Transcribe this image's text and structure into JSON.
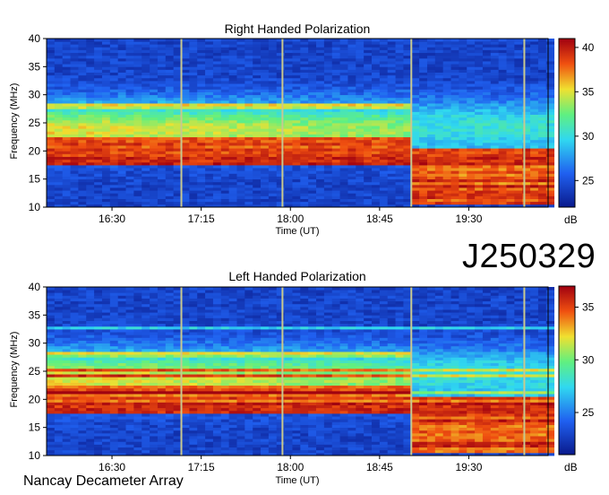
{
  "identifier": "J250329",
  "observatory": "Nancay Decameter Array",
  "chart_data": [
    {
      "type": "heatmap",
      "title": "Right Handed Polarization",
      "xlabel": "Time (UT)",
      "ylabel": "Frequency (MHz)",
      "x_ticks": [
        "16:30",
        "17:15",
        "18:00",
        "18:45",
        "19:30"
      ],
      "y_ticks": [
        10,
        15,
        20,
        25,
        30,
        35,
        40
      ],
      "ylim": [
        10,
        40
      ],
      "colorbar": {
        "ticks": [
          25,
          30,
          35,
          40
        ],
        "units": "dB",
        "range": [
          22,
          41
        ]
      },
      "features": {
        "vertical_lines_time": [
          "17:05",
          "17:56",
          "19:01",
          "19:58"
        ],
        "bands_before_19_00_MHz": [
          [
            17.5,
            22.5
          ],
          [
            27.5,
            28.5
          ]
        ],
        "bands_after_19_00_MHz": [
          [
            10.5,
            20.5
          ]
        ]
      }
    },
    {
      "type": "heatmap",
      "title": "Left Handed Polarization",
      "xlabel": "Time (UT)",
      "ylabel": "Frequency (MHz)",
      "x_ticks": [
        "16:30",
        "17:15",
        "18:00",
        "18:45",
        "19:30"
      ],
      "y_ticks": [
        10,
        15,
        20,
        25,
        30,
        35,
        40
      ],
      "ylim": [
        10,
        40
      ],
      "colorbar": {
        "ticks": [
          25,
          30,
          35
        ],
        "units": "dB",
        "range": [
          21,
          37
        ]
      },
      "features": {
        "vertical_lines_time": [
          "17:05",
          "17:56",
          "19:01",
          "19:58"
        ],
        "bands_before_19_00_MHz": [
          [
            17.5,
            22.5
          ],
          [
            27.5,
            28.5
          ]
        ],
        "bands_after_19_00_MHz": [
          [
            10.5,
            20.5
          ]
        ]
      }
    }
  ],
  "colors": {
    "low": "#0a1a8c",
    "mid_blue": "#2a5ae0",
    "cyan": "#30d8f0",
    "yellow": "#f0e030",
    "high": "#b00010"
  }
}
